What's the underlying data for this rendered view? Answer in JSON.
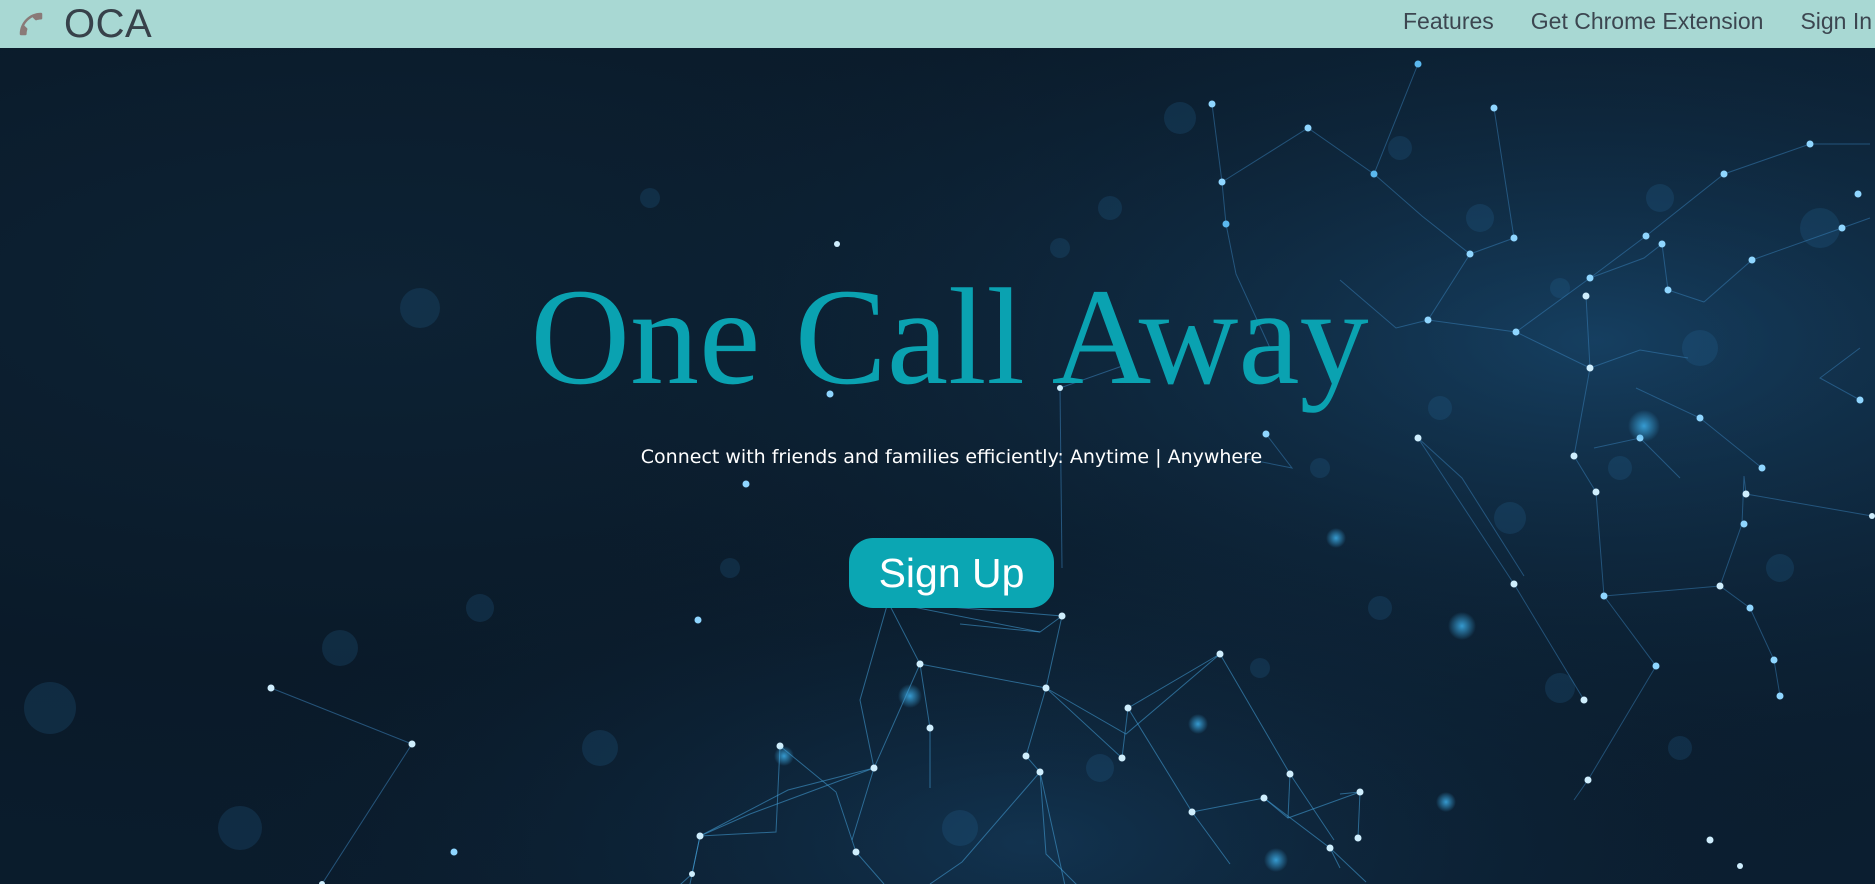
{
  "navbar": {
    "brand_icon": "phone-icon",
    "brand_name": "OCA",
    "links": [
      "Features",
      "Get Chrome Extension",
      "Sign In"
    ]
  },
  "hero": {
    "title": "One Call Away",
    "subtitle": "Connect with friends and families efficiently: Anytime | Anywhere",
    "cta_label": "Sign Up"
  },
  "colors": {
    "navbar_bg": "#a8d8d3",
    "accent_teal": "#0aa2b1",
    "hero_bg": "#0b1c2c",
    "phone_icon": "#8a7a78"
  }
}
